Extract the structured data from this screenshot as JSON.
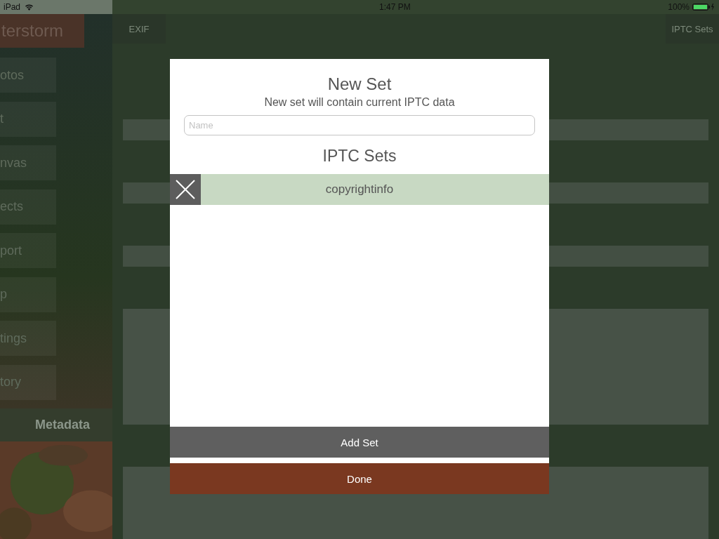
{
  "status_bar": {
    "device": "iPad",
    "time": "1:47 PM",
    "battery": "100%"
  },
  "sidebar": {
    "logo": "terstorm",
    "items": [
      {
        "label": "otos",
        "selected": false
      },
      {
        "label": "t",
        "selected": false
      },
      {
        "label": "nvas",
        "selected": false
      },
      {
        "label": "ects",
        "selected": false
      },
      {
        "label": "port",
        "selected": false
      },
      {
        "label": "p",
        "selected": false
      },
      {
        "label": "tings",
        "selected": false
      },
      {
        "label": "tory",
        "selected": false
      },
      {
        "label": "Metadata",
        "selected": true
      }
    ]
  },
  "toolbar": {
    "left_button": "EXIF",
    "right_button": "IPTC Sets"
  },
  "dialog": {
    "title": "New Set",
    "subtitle": "New set will contain current IPTC data",
    "name_field": {
      "placeholder": "Name"
    },
    "sets_heading": "IPTC Sets",
    "sets": [
      {
        "name": "copyrightinfo"
      }
    ],
    "buttons": [
      {
        "label": "Add Set",
        "kind": "secondary"
      },
      {
        "label": "Done",
        "kind": "primary"
      }
    ]
  }
}
